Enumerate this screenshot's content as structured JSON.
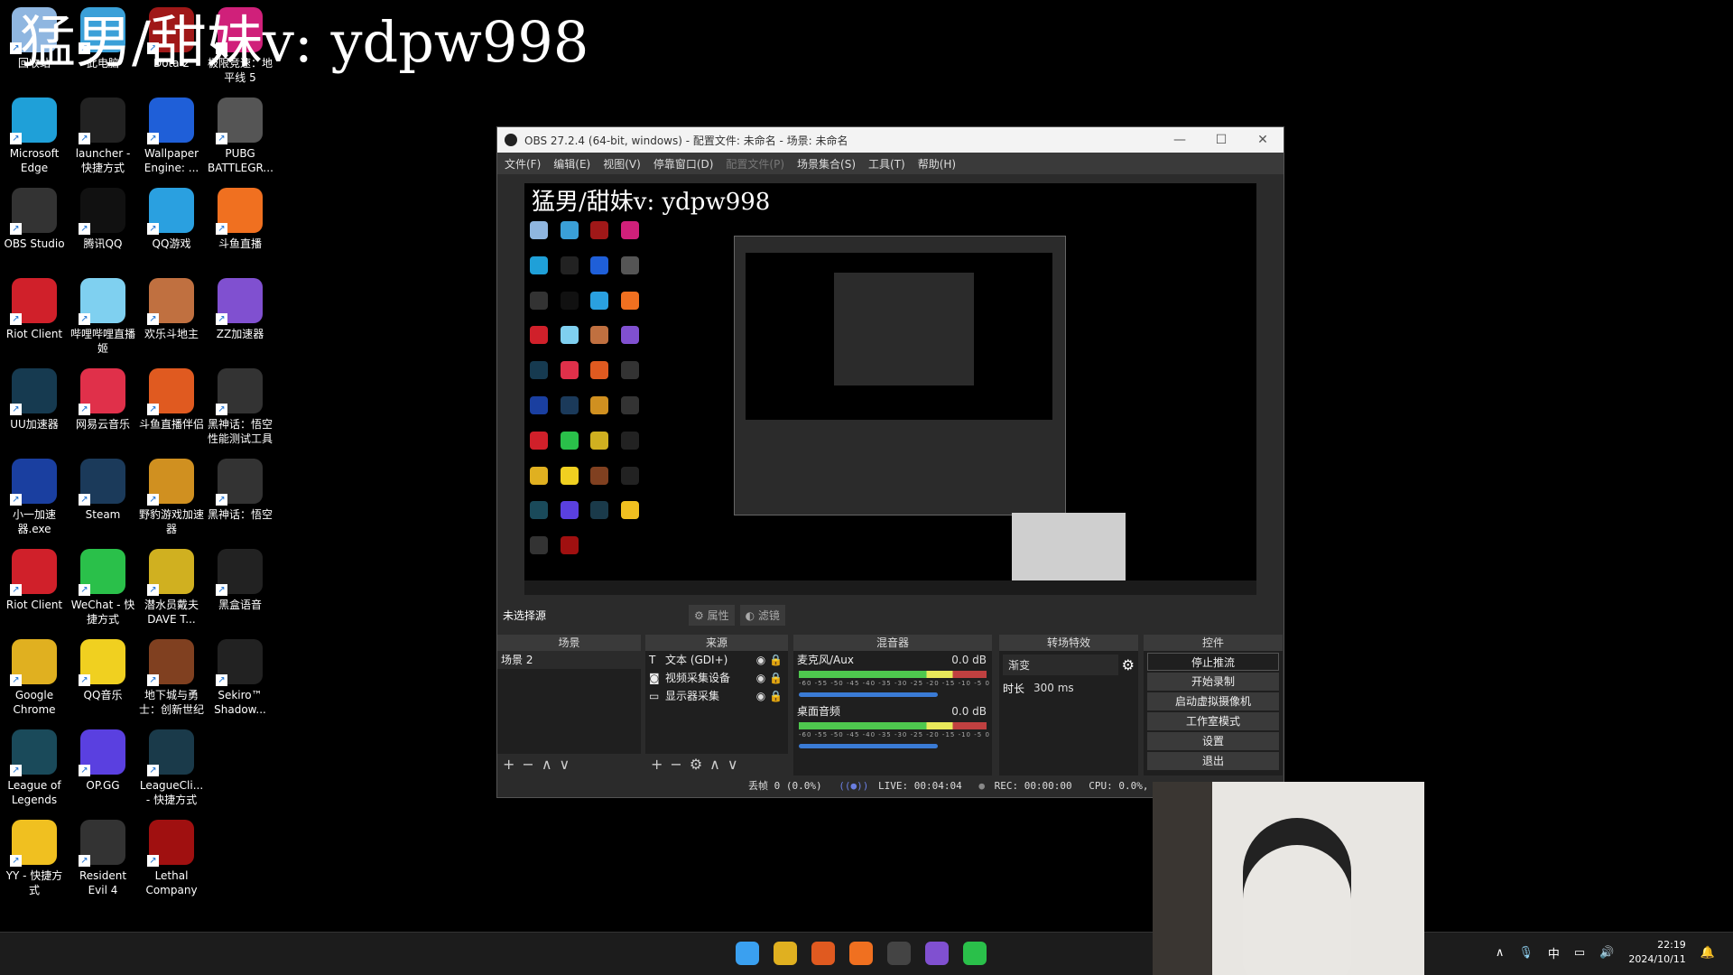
{
  "overlay_title": "猛男/甜妹v: ydpw998",
  "desktop_icons": [
    {
      "label": "回收站",
      "color": "#8fb6e0"
    },
    {
      "label": "此电脑",
      "color": "#3aa0d8"
    },
    {
      "label": "Dota 2",
      "color": "#a01818"
    },
    {
      "label": "极限竞速：地平线 5",
      "color": "#d0207a"
    },
    {
      "label": "Microsoft Edge",
      "color": "#1fa0d8"
    },
    {
      "label": "launcher - 快捷方式",
      "color": "#222"
    },
    {
      "label": "Wallpaper Engine: ...",
      "color": "#1f5fd8"
    },
    {
      "label": "PUBG BATTLEGR...",
      "color": "#555"
    },
    {
      "label": "OBS Studio",
      "color": "#333"
    },
    {
      "label": "腾讯QQ",
      "color": "#111"
    },
    {
      "label": "QQ游戏",
      "color": "#2aa0e0"
    },
    {
      "label": "斗鱼直播",
      "color": "#f07020"
    },
    {
      "label": "Riot Client",
      "color": "#d0202a"
    },
    {
      "label": "哔哩哔哩直播姬",
      "color": "#7fd0f0"
    },
    {
      "label": "欢乐斗地主",
      "color": "#c07040"
    },
    {
      "label": "ZZ加速器",
      "color": "#8050d0"
    },
    {
      "label": "UU加速器",
      "color": "#163a50"
    },
    {
      "label": "网易云音乐",
      "color": "#e0304a"
    },
    {
      "label": "斗鱼直播伴侣",
      "color": "#e05a20"
    },
    {
      "label": "黑神话：悟空性能测试工具",
      "color": "#333"
    },
    {
      "label": "小一加速器.exe",
      "color": "#1a3fa0"
    },
    {
      "label": "Steam",
      "color": "#1b3a5a"
    },
    {
      "label": "野豹游戏加速器",
      "color": "#d09020"
    },
    {
      "label": "黑神话：悟空",
      "color": "#333"
    },
    {
      "label": "Riot Client",
      "color": "#d0202a"
    },
    {
      "label": "WeChat - 快捷方式",
      "color": "#2ac04a"
    },
    {
      "label": "潜水员戴夫 DAVE T...",
      "color": "#d0b020"
    },
    {
      "label": "黑盒语音",
      "color": "#222"
    },
    {
      "label": "Google Chrome",
      "color": "#e0b020"
    },
    {
      "label": "QQ音乐",
      "color": "#f0d020"
    },
    {
      "label": "地下城与勇士：创新世纪",
      "color": "#804020"
    },
    {
      "label": "Sekiro™ Shadow...",
      "color": "#222"
    },
    {
      "label": "League of Legends",
      "color": "#1a4a5a"
    },
    {
      "label": "OP.GG",
      "color": "#5a40e0"
    },
    {
      "label": "LeagueCli... - 快捷方式",
      "color": "#1a3a4a"
    },
    {
      "label": "YY - 快捷方式",
      "color": "#f0c020"
    },
    {
      "label": "Resident Evil 4",
      "color": "#333"
    },
    {
      "label": "Lethal Company",
      "color": "#a01010"
    }
  ],
  "obs": {
    "title": "OBS 27.2.4 (64-bit, windows) - 配置文件: 未命名 - 场景: 未命名",
    "menu": [
      "文件(F)",
      "编辑(E)",
      "视图(V)",
      "停靠窗口(D)",
      "配置文件(P)",
      "场景集合(S)",
      "工具(T)",
      "帮助(H)"
    ],
    "preview_title": "猛男/甜妹v: ydpw998",
    "no_source": "未选择源",
    "properties": "属性",
    "filters": "滤镜",
    "docks": {
      "scenes": "场景",
      "sources": "来源",
      "mixer": "混音器",
      "transitions": "转场特效",
      "controls": "控件"
    },
    "scenes": [
      "场景 2"
    ],
    "sources": [
      {
        "icon": "text-icon",
        "label": "文本 (GDI+)"
      },
      {
        "icon": "camera-icon",
        "label": "视频采集设备"
      },
      {
        "icon": "monitor-icon",
        "label": "显示器采集"
      }
    ],
    "mixer": [
      {
        "name": "麦克风/Aux",
        "db": "0.0 dB"
      },
      {
        "name": "桌面音频",
        "db": "0.0 dB"
      }
    ],
    "meter_scale": "-60 -55 -50 -45 -40 -35 -30 -25 -20 -15 -10 -5 0",
    "transition": "渐变",
    "duration_label": "时长",
    "duration": "300 ms",
    "controls": [
      "停止推流",
      "开始录制",
      "启动虚拟摄像机",
      "工作室模式",
      "设置",
      "退出"
    ],
    "status": {
      "dropped": "丢帧 0 (0.0%)",
      "live": "LIVE: 00:04:04",
      "rec": "REC: 00:00:00",
      "cpu": "CPU: 0.0%, 60.00 fps"
    }
  },
  "taskbar": {
    "icons": [
      {
        "name": "windows-start-icon",
        "color": "#3aa0f0"
      },
      {
        "name": "chrome-icon",
        "color": "#e0b020"
      },
      {
        "name": "douyu-companion-icon",
        "color": "#e05a20"
      },
      {
        "name": "douyu-icon",
        "color": "#f07020"
      },
      {
        "name": "obs-icon",
        "color": "#444"
      },
      {
        "name": "zz-accelerator-icon",
        "color": "#8050d0"
      },
      {
        "name": "wechat-icon",
        "color": "#2ac04a"
      }
    ],
    "ime": "中",
    "time": "22:19",
    "date": "2024/10/11"
  }
}
